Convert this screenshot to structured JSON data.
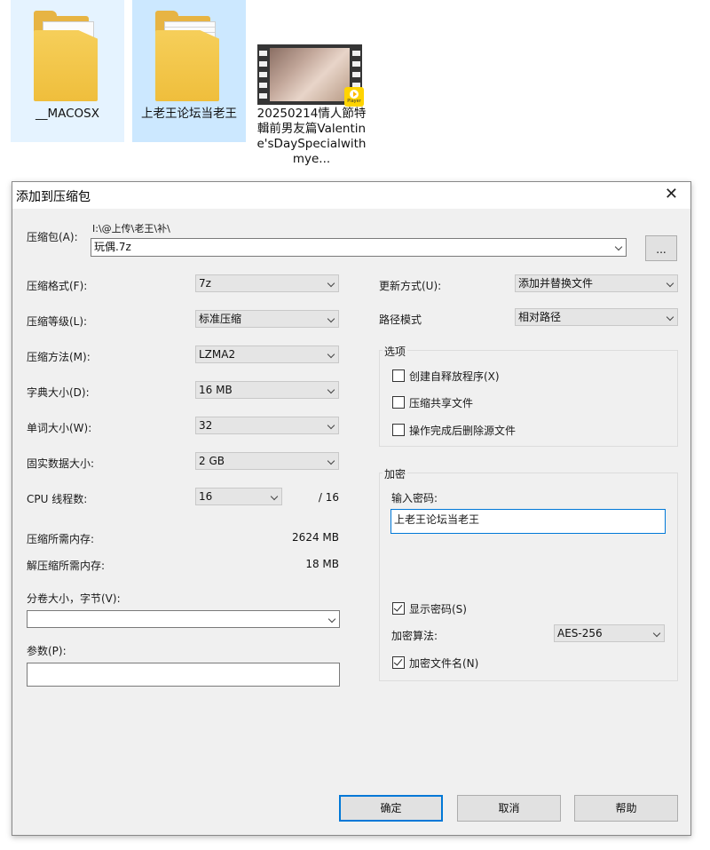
{
  "explorer": {
    "files": [
      {
        "name": "__MACOSX"
      },
      {
        "name": "上老王论坛当老王"
      },
      {
        "name": "20250214情人節特輯前男友篇Valentine'sDaySpecialwithmye...",
        "badge_label": "Player"
      }
    ]
  },
  "dialog": {
    "title": "添加到压缩包",
    "archive": {
      "label": "压缩包(A):",
      "path": "I:\\@上传\\老王\\补\\",
      "filename": "玩偶.7z",
      "browse_label": "..."
    },
    "left": {
      "format_label": "压缩格式(F):",
      "format_value": "7z",
      "level_label": "压缩等级(L):",
      "level_value": "标准压缩",
      "method_label": "压缩方法(M):",
      "method_value": "LZMA2",
      "dict_label": "字典大小(D):",
      "dict_value": "16 MB",
      "word_label": "单词大小(W):",
      "word_value": "32",
      "solid_label": "固实数据大小:",
      "solid_value": "2 GB",
      "cpu_label": "CPU 线程数:",
      "cpu_value": "16",
      "cpu_total": "/ 16",
      "mem_compress_label": "压缩所需内存:",
      "mem_compress_value": "2624 MB",
      "mem_decompress_label": "解压缩所需内存:",
      "mem_decompress_value": "18 MB",
      "split_label": "分卷大小，字节(V):",
      "split_value": "",
      "params_label": "参数(P):",
      "params_value": ""
    },
    "right": {
      "update_label": "更新方式(U):",
      "update_value": "添加并替换文件",
      "path_label": "路径模式",
      "path_value": "相对路径",
      "options_title": "选项",
      "opt_sfx": "创建自释放程序(X)",
      "opt_shared": "压缩共享文件",
      "opt_delete": "操作完成后删除源文件",
      "encrypt_title": "加密",
      "password_label": "输入密码:",
      "password_value": "上老王论坛当老王",
      "show_password": "显示密码(S)",
      "method_label": "加密算法:",
      "method_value": "AES-256",
      "encrypt_names": "加密文件名(N)"
    },
    "buttons": {
      "ok": "确定",
      "cancel": "取消",
      "help": "帮助"
    }
  }
}
